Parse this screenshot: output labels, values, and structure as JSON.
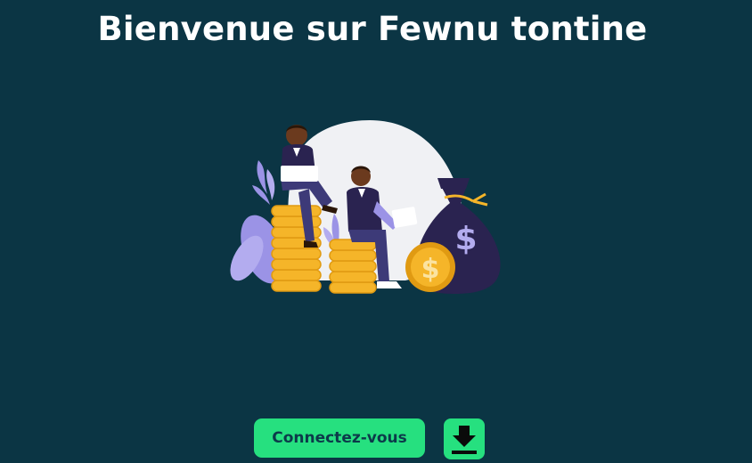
{
  "header": {
    "title": "Bienvenue sur Fewnu tontine"
  },
  "illustration": {
    "icon": "finance-illustration",
    "colors": {
      "coin": "#f5b529",
      "coin_dark": "#e09a12",
      "bag": "#2a2350",
      "lavender": "#9b93e6",
      "backdrop": "#f0f1f4",
      "skin": "#6b3a1e"
    }
  },
  "actions": {
    "connect_label": "Connectez-vous",
    "download_icon": "download-icon"
  },
  "theme": {
    "background": "#0b3544",
    "accent": "#26e07f",
    "button_text": "#0c3a4a"
  }
}
